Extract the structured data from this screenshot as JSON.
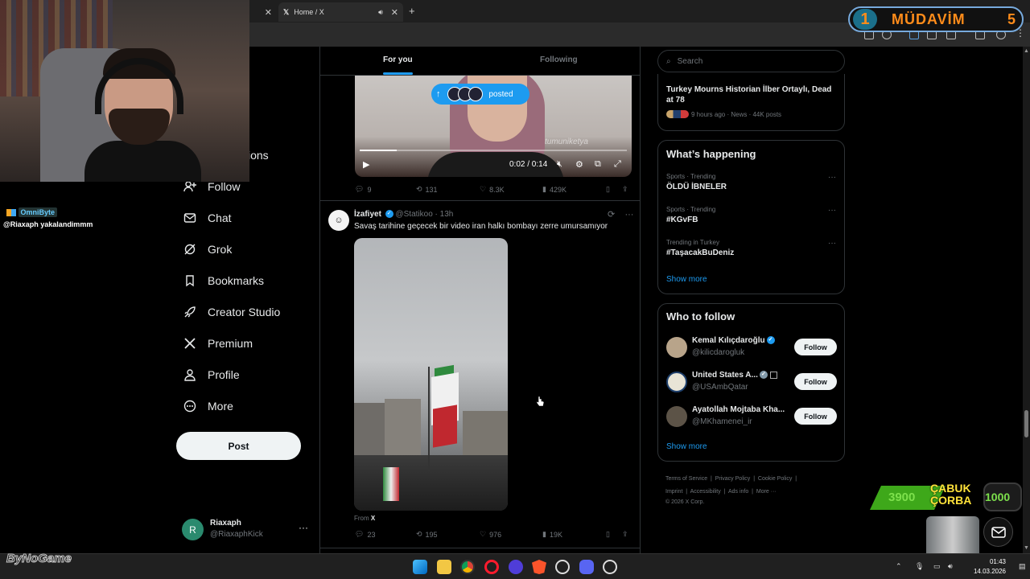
{
  "browser": {
    "tabs": [
      {
        "title": ""
      },
      {
        "title": "Home / X"
      }
    ],
    "new_tab_label": "+"
  },
  "overlay": {
    "chat_user": "OmniByte",
    "chat_message": "@Riaxaph yakalandimmm",
    "mudavim_rank": "1",
    "mudavim_label": "MÜDAVİM",
    "mudavim_count": "5",
    "cabuk_number": "3900",
    "cabuk_text": "ÇABUK ÇORBA",
    "k1000": "1000",
    "logo": "ByNoGame"
  },
  "nav": {
    "partial": "ions",
    "items": [
      {
        "label": "Follow",
        "icon": "person-add-icon"
      },
      {
        "label": "Chat",
        "icon": "mail-icon"
      },
      {
        "label": "Grok",
        "icon": "grok-icon"
      },
      {
        "label": "Bookmarks",
        "icon": "bookmark-icon"
      },
      {
        "label": "Creator Studio",
        "icon": "rocket-icon"
      },
      {
        "label": "Premium",
        "icon": "x-logo-icon"
      },
      {
        "label": "Profile",
        "icon": "person-icon"
      },
      {
        "label": "More",
        "icon": "more-circle-icon"
      }
    ],
    "post_label": "Post",
    "account": {
      "initial": "R",
      "name": "Riaxaph",
      "handle": "@RiaxaphKick"
    }
  },
  "timeline": {
    "tabs": {
      "for_you": "For you",
      "following": "Following"
    },
    "posted_label": "posted",
    "tweet1": {
      "video_watermark": "tumuniketya",
      "video_time": "0:02 / 0:14",
      "video_progress": 0.14,
      "replies": "9",
      "reposts": "131",
      "likes": "8.3K",
      "views": "429K"
    },
    "tweet2": {
      "name": "İzafiyet",
      "handle": "@Statikoo",
      "time": "13h",
      "text": "Savaş  tarihine geçecek bir video iran halkı bombayı zerre umursamıyor",
      "from_prefix": "From",
      "from_source": "X",
      "replies": "23",
      "reposts": "195",
      "likes": "976",
      "views": "19K"
    }
  },
  "sidebar": {
    "search_placeholder": "Search",
    "news": {
      "title": "Turkey Mourns Historian İlber Ortaylı, Dead at 78",
      "meta": "9 hours ago · News · 44K posts"
    },
    "trends_title": "What’s happening",
    "trends": [
      {
        "category": "Sports · Trending",
        "name": "ÖLDÜ İBNELER"
      },
      {
        "category": "Sports · Trending",
        "name": "#KGvFB"
      },
      {
        "category": "Trending in Turkey",
        "name": "#TaşacakBuDeniz"
      }
    ],
    "show_more": "Show more",
    "who_to_follow_title": "Who to follow",
    "who_to_follow": [
      {
        "name": "Kemal Kılıçdaroğlu",
        "handle": "@kilicdarogluk"
      },
      {
        "name": "United States A...",
        "handle": "@USAmbQatar"
      },
      {
        "name": "Ayatollah Mojtaba Kha...",
        "handle": "@MKhamenei_ir"
      }
    ],
    "follow_label": "Follow",
    "footer": {
      "links_row1": [
        "Terms of Service",
        "Privacy Policy",
        "Cookie Policy"
      ],
      "links_row2": [
        "Imprint",
        "Accessibility",
        "Ads info",
        "More ···"
      ],
      "copyright": "© 2026 X Corp."
    }
  },
  "taskbar": {
    "time": "01:43",
    "date": "14.03.2026"
  }
}
